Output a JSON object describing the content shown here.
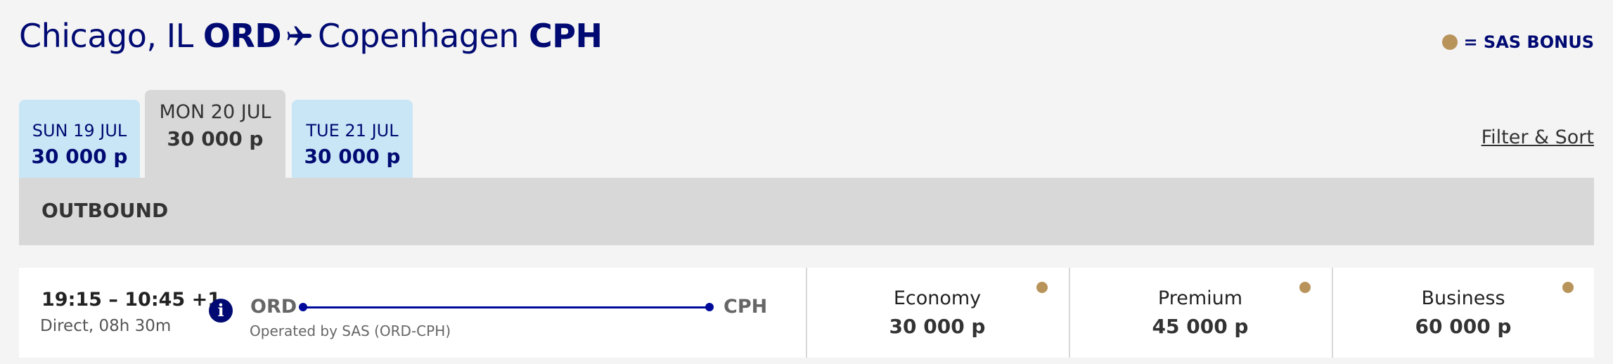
{
  "header": {
    "origin_city": "Chicago, IL",
    "origin_code": "ORD",
    "destination_city": "Copenhagen",
    "destination_code": "CPH",
    "plane_icon": "airplane-icon"
  },
  "legend": {
    "label": "= SAS BONUS",
    "dot_color": "#b8935a"
  },
  "date_tabs": [
    {
      "day": "SUN 19 JUL",
      "price": "30 000 p",
      "selected": false
    },
    {
      "day": "MON 20 JUL",
      "price": "30 000 p",
      "selected": true
    },
    {
      "day": "TUE 21 JUL",
      "price": "30 000 p",
      "selected": false
    }
  ],
  "filter_sort": "Filter & Sort",
  "section_title": "OUTBOUND",
  "flight": {
    "times": "19:15 – 10:45 +1",
    "duration": "Direct, 08h 30m",
    "info_icon": "info-icon",
    "origin": "ORD",
    "destination": "CPH",
    "operated_by": "Operated by SAS (ORD-CPH)",
    "fares": [
      {
        "class": "Economy",
        "price": "30 000 p"
      },
      {
        "class": "Premium",
        "price": "45 000 p"
      },
      {
        "class": "Business",
        "price": "60 000 p"
      }
    ]
  },
  "colors": {
    "brand_navy": "#000a72",
    "tab_blue": "#c9e6f7",
    "tab_selected": "#d8d8d8",
    "bonus_gold": "#b8935a"
  }
}
